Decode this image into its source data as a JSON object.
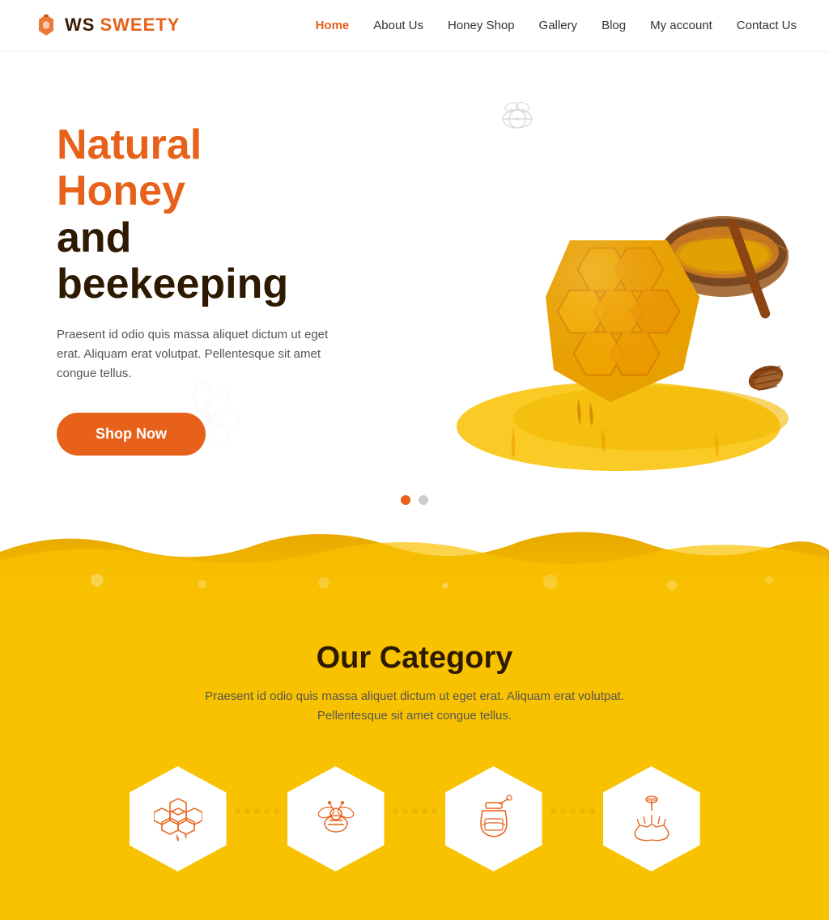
{
  "brand": {
    "prefix": "WS",
    "name": "SWEETY"
  },
  "nav": {
    "items": [
      {
        "label": "Home",
        "active": true
      },
      {
        "label": "About Us",
        "active": false
      },
      {
        "label": "Honey Shop",
        "active": false
      },
      {
        "label": "Gallery",
        "active": false
      },
      {
        "label": "Blog",
        "active": false
      },
      {
        "label": "My account",
        "active": false
      },
      {
        "label": "Contact Us",
        "active": false
      }
    ]
  },
  "hero": {
    "title_line1": "Natural Honey",
    "title_line2": "and beekeeping",
    "description": "Praesent id odio quis massa aliquet dictum ut eget erat. Aliquam erat volutpat. Pellentesque sit amet congue tellus.",
    "cta_label": "Shop Now"
  },
  "carousel": {
    "dots": [
      {
        "active": true
      },
      {
        "active": false
      }
    ]
  },
  "category": {
    "title": "Our Category",
    "description": "Praesent id odio quis massa aliquet dictum ut eget erat. Aliquam erat volutpat.\nPellentesque sit amet congue tellus.",
    "items": [
      {
        "icon": "honeycomb-icon",
        "label": "Honeycomb"
      },
      {
        "icon": "bee-icon",
        "label": "Bee"
      },
      {
        "icon": "jar-icon",
        "label": "Honey Jar"
      },
      {
        "icon": "dipper-icon",
        "label": "Honey Dipper"
      }
    ]
  },
  "colors": {
    "orange": "#e8611a",
    "dark_brown": "#2d1a00",
    "yellow": "#f9c200"
  }
}
